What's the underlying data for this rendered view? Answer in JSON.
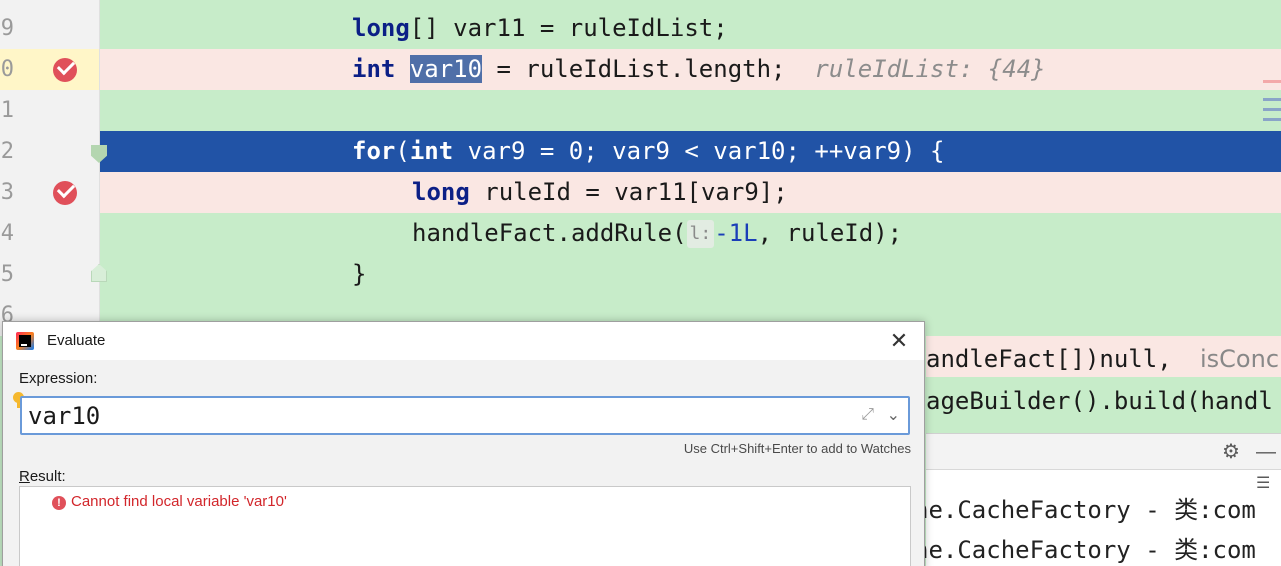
{
  "editor": {
    "lines": [
      {
        "num": "9",
        "kind": "normal",
        "indent": 1,
        "code": "long[] var11 = ruleIdList;"
      },
      {
        "num": "0",
        "kind": "breakpoint",
        "indent": 1,
        "code": "int var10 = ruleIdList.length;",
        "hint": "ruleIdList: {44}"
      },
      {
        "num": "1",
        "kind": "normal",
        "indent": 1,
        "code": ""
      },
      {
        "num": "2",
        "kind": "execution",
        "indent": 1,
        "code": "for(int var9 = 0; var9 < var10; ++var9) {"
      },
      {
        "num": "3",
        "kind": "breakpoint",
        "indent": 2,
        "code": "long ruleId = var11[var9];"
      },
      {
        "num": "4",
        "kind": "normal",
        "indent": 2,
        "code": "handleFact.addRule(",
        "param_hint": "l:",
        "arg": "-1L",
        "rest": ", ruleId);"
      },
      {
        "num": "5",
        "kind": "normal",
        "indent": 1,
        "code": "}"
      },
      {
        "num": "6",
        "kind": "normal",
        "indent": 1,
        "code": ""
      }
    ],
    "right_code": {
      "line1": "andleFact[])null,",
      "line1_hint": "isConc",
      "line2": "ageBuilder().build(handl"
    },
    "console": {
      "lines": [
        "he.CacheFactory - 类:com",
        "he.CacheFactory - 类:com"
      ]
    },
    "colors": {
      "normal_bg": "#c7ecc9",
      "breakpoint_bg": "#fae7e3",
      "execution_bg": "#2153a6",
      "keyword": "#0b1f86"
    }
  },
  "dialog": {
    "title": "Evaluate",
    "expression_label": "Expression:",
    "expression_value": "var10",
    "watch_hint": "Use Ctrl+Shift+Enter to add to Watches",
    "result_label_first": "R",
    "result_label_rest": "esult:",
    "error_message": "Cannot find local variable 'var10'",
    "icons": {
      "app": "intellij-icon",
      "close": "close-icon",
      "expand": "expand-icon",
      "history": "chevron-down-icon",
      "error": "error-icon",
      "bulb": "lightbulb-icon"
    }
  }
}
